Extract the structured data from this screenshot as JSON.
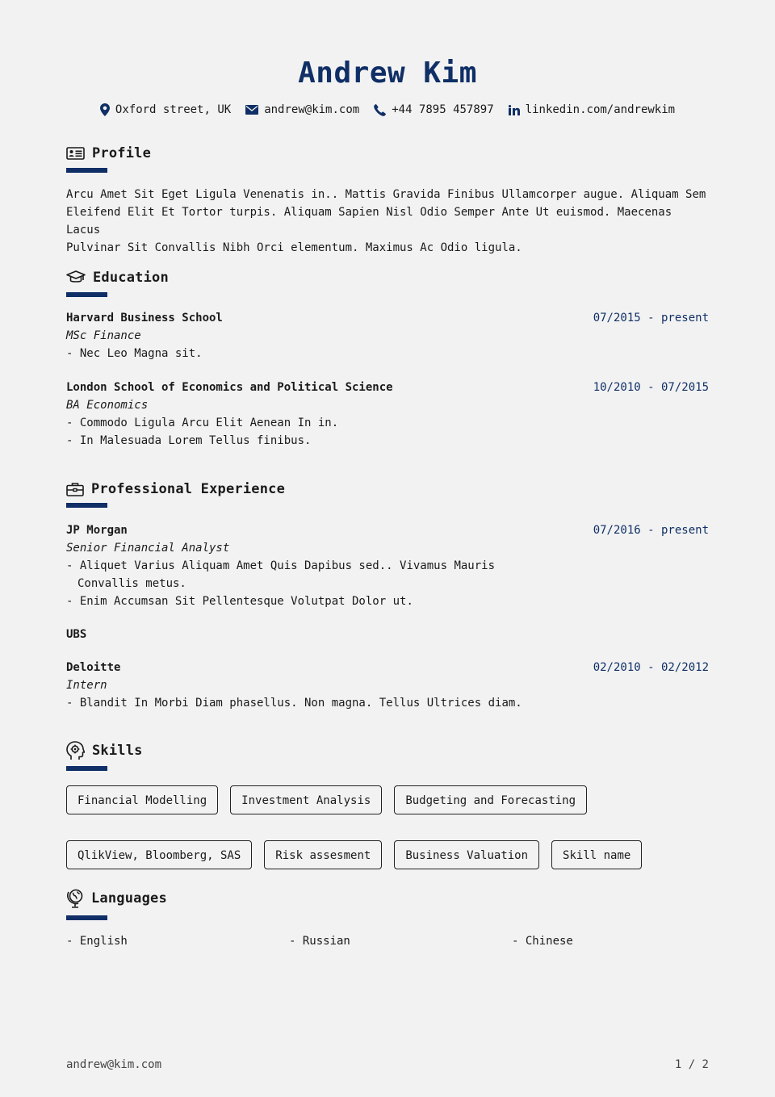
{
  "header": {
    "name": "Andrew Kim",
    "contacts": {
      "address": "Oxford street, UK",
      "email": "andrew@kim.com",
      "phone": "+44 7895 457897",
      "linkedin": "linkedin.com/andrewkim"
    }
  },
  "colors": {
    "accent": "#0f2f66",
    "background": "#f2f2f2",
    "text": "#1a1a1a"
  },
  "profile": {
    "title": "Profile",
    "icon": "id-card-icon",
    "lines": [
      "Arcu Amet Sit Eget Ligula Venenatis in.. Mattis Gravida Finibus Ullamcorper augue. Aliquam Sem",
      "Eleifend Elit Et Tortor turpis. Aliquam Sapien Nisl Odio Semper Ante Ut euismod. Maecenas Lacus",
      "Pulvinar Sit Convallis Nibh Orci elementum. Maximus Ac Odio ligula."
    ]
  },
  "education": {
    "title": "Education",
    "icon": "graduation-cap-icon",
    "items": [
      {
        "org": "Harvard Business School",
        "date": "07/2015 - present",
        "role": "MSc Finance",
        "bullets": [
          "Nec Leo Magna sit."
        ]
      },
      {
        "org": "London School of Economics and Political Science",
        "date": "10/2010 - 07/2015",
        "role": "BA Economics",
        "bullets": [
          "Commodo Ligula Arcu Elit Aenean In in.",
          "In Malesuada Lorem Tellus finibus."
        ]
      }
    ]
  },
  "experience": {
    "title": "Professional Experience",
    "icon": "briefcase-icon",
    "items": [
      {
        "org": "JP Morgan",
        "date": "07/2016 - present",
        "role": "Senior Financial Analyst",
        "bullets": [
          "Aliquet Varius Aliquam Amet Quis Dapibus sed.. Vivamus Mauris Convallis metus.",
          "Enim Accumsan Sit Pellentesque Volutpat Dolor ut."
        ]
      },
      {
        "org": "UBS"
      },
      {
        "org": "Deloitte",
        "date": "02/2010 - 02/2012",
        "role": "Intern",
        "bullets": [
          "Blandit In Morbi Diam phasellus. Non magna. Tellus Ultrices diam."
        ]
      }
    ]
  },
  "skills": {
    "title": "Skills",
    "icon": "head-gears-icon",
    "items": [
      "Financial Modelling",
      "Investment Analysis",
      "Budgeting and Forecasting",
      "QlikView, Bloomberg, SAS",
      "Risk assesment",
      "Business Valuation",
      "Skill name"
    ]
  },
  "languages": {
    "title": "Languages",
    "icon": "globe-icon",
    "items": [
      "English",
      "Russian",
      "Chinese"
    ]
  },
  "footer": {
    "email": "andrew@kim.com",
    "page": "1 / 2"
  }
}
